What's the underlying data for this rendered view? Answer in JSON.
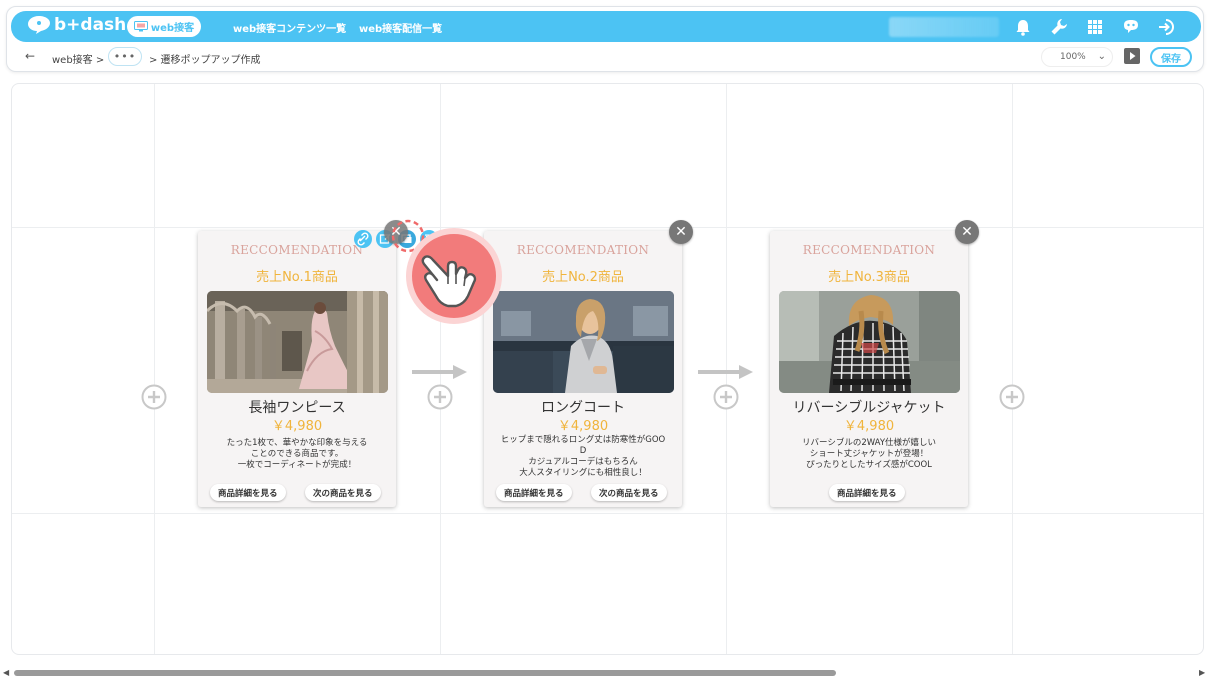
{
  "header": {
    "logo_text": "b+dash",
    "active_tab": "web接客",
    "nav_links": [
      "web接客コンテンツ一覧",
      "web接客配信一覧"
    ],
    "accent_color": "#4cc3f3",
    "icons": [
      "bell-icon",
      "wrench-icon",
      "grid-icon",
      "chat-bot-icon",
      "logout-icon"
    ]
  },
  "subbar": {
    "breadcrumb_root": "web接客 >",
    "breadcrumb_dots": "•••",
    "breadcrumb_current": "> 遷移ポップアップ作成",
    "zoom": "100%",
    "save_label": "保存"
  },
  "cards": [
    {
      "eyebrow": "RECCOMENDATION",
      "rank": "売上No.1商品",
      "name": "長袖ワンピース",
      "price": "￥4,980",
      "desc": [
        "たった1枚で、華やかな印象を与える",
        "ことのできる商品です。",
        "一枚でコーディネートが完成！"
      ],
      "buttons": [
        "商品詳細を見る",
        "次の商品を見る"
      ]
    },
    {
      "eyebrow": "RECCOMENDATION",
      "rank": "売上No.2商品",
      "name": "ロングコート",
      "price": "￥4,980",
      "desc": [
        "ヒップまで隠れるロング丈は防寒性がGOO",
        "D",
        "カジュアルコーデはもちろん",
        "大人スタイリングにも相性良し！"
      ],
      "buttons": [
        "商品詳細を見る",
        "次の商品を見る"
      ]
    },
    {
      "eyebrow": "RECCOMENDATION",
      "rank": "売上No.3商品",
      "name": "リバーシブルジャケット",
      "price": "￥4,980",
      "desc": [
        "リバーシブルの2WAY仕様が嬉しい",
        "ショート丈ジャケットが登場！",
        "ぴったりとしたサイズ感がCOOL"
      ],
      "buttons": [
        "商品詳細を見る"
      ]
    }
  ],
  "close_glyph": "✕",
  "colors": {
    "eyebrow": "#d9a39c",
    "rank_and_price": "#f0b43c",
    "hand_pointer": "#f08080"
  }
}
